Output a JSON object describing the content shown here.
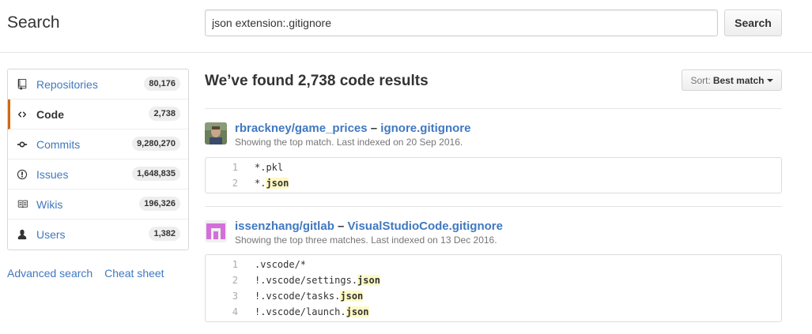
{
  "header": {
    "title": "Search",
    "search_value": "json extension:.gitignore",
    "search_button": "Search"
  },
  "sidebar": {
    "items": [
      {
        "label": "Repositories",
        "count": "80,176",
        "icon": "repo-icon"
      },
      {
        "label": "Code",
        "count": "2,738",
        "icon": "code-icon"
      },
      {
        "label": "Commits",
        "count": "9,280,270",
        "icon": "commit-icon"
      },
      {
        "label": "Issues",
        "count": "1,648,835",
        "icon": "issue-icon"
      },
      {
        "label": "Wikis",
        "count": "196,326",
        "icon": "book-icon"
      },
      {
        "label": "Users",
        "count": "1,382",
        "icon": "person-icon"
      }
    ],
    "selected": "Code",
    "links": {
      "advanced": "Advanced search",
      "cheat": "Cheat sheet"
    }
  },
  "main": {
    "results_title": "We’ve found 2,738 code results",
    "sort_prefix": "Sort:",
    "sort_value": "Best match",
    "results": [
      {
        "repo": "rbrackney/game_prices",
        "dash": "–",
        "file": "ignore.gitignore",
        "meta": "Showing the top match. Last indexed on 20 Sep 2016.",
        "lines": [
          {
            "num": "1",
            "pre": "*.pkl",
            "hl": "",
            "post": ""
          },
          {
            "num": "2",
            "pre": "*.",
            "hl": "json",
            "post": ""
          }
        ]
      },
      {
        "repo": "issenzhang/gitlab",
        "dash": "–",
        "file": "VisualStudioCode.gitignore",
        "meta": "Showing the top three matches. Last indexed on 13 Dec 2016.",
        "lines": [
          {
            "num": "1",
            "pre": ".vscode/*",
            "hl": "",
            "post": ""
          },
          {
            "num": "2",
            "pre": "!.vscode/settings.",
            "hl": "json",
            "post": ""
          },
          {
            "num": "3",
            "pre": "!.vscode/tasks.",
            "hl": "json",
            "post": ""
          },
          {
            "num": "4",
            "pre": "!.vscode/launch.",
            "hl": "json",
            "post": ""
          }
        ]
      }
    ]
  },
  "colors": {
    "link": "#4078c0",
    "selected_border": "#d26911",
    "highlight": "#fff9c4"
  }
}
